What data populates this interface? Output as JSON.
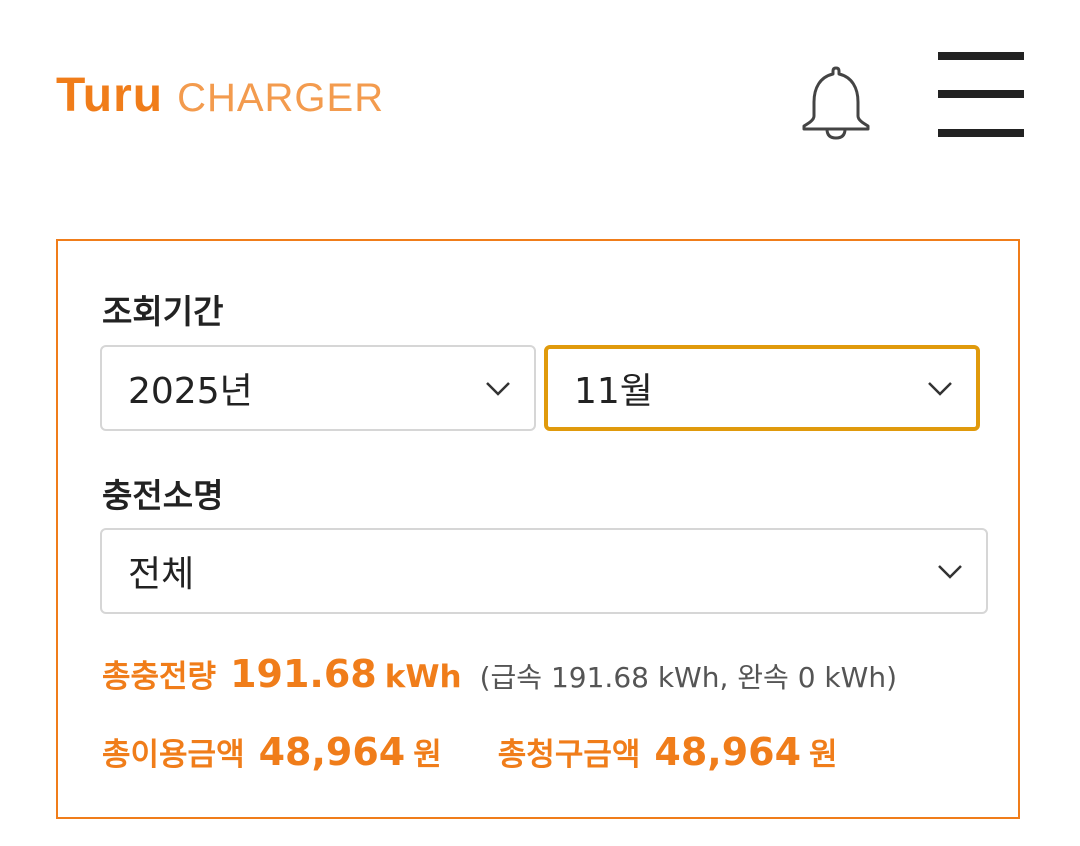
{
  "header": {
    "logo_turu": "Turu",
    "logo_charger": "CHARGER",
    "bell_icon": "bell-icon",
    "menu_icon": "hamburger-menu-icon"
  },
  "filters": {
    "period_label": "조회기간",
    "year_value": "2025년",
    "month_value": "11월",
    "station_label": "충전소명",
    "station_value": "전체"
  },
  "summary": {
    "total_charge_label": "총충전량",
    "total_charge_value": "191.68",
    "total_charge_unit": "kWh",
    "charge_breakdown": "(급속 191.68 kWh, 완속 0 kWh)",
    "total_usage_label": "총이용금액",
    "total_usage_value": "48,964",
    "total_usage_unit": "원",
    "total_billed_label": "총청구금액",
    "total_billed_value": "48,964",
    "total_billed_unit": "원"
  },
  "colors": {
    "accent": "#f07d1a",
    "focus_border": "#e09a0c",
    "text": "#222222"
  }
}
